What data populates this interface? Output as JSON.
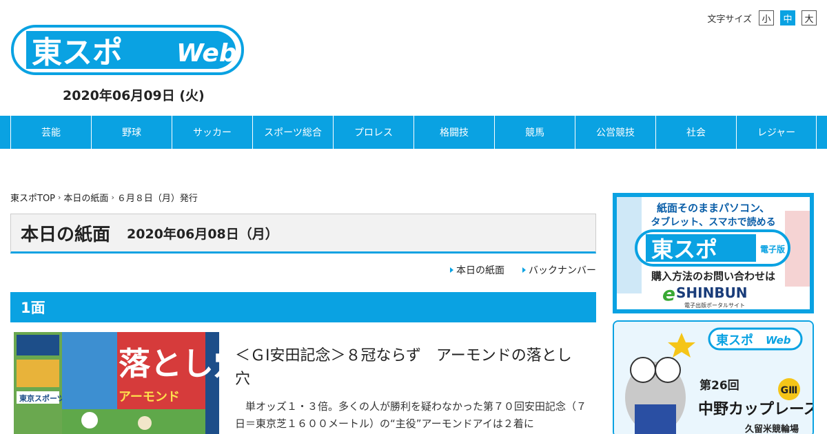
{
  "header": {
    "logo_text": "東スポ",
    "logo_web": "Web",
    "date": "2020年06月09日 (火)"
  },
  "font_size": {
    "label": "文字サイズ",
    "options": [
      "小",
      "中",
      "大"
    ],
    "selected": "中"
  },
  "nav": {
    "items": [
      "芸能",
      "野球",
      "サッカー",
      "スポーツ総合",
      "プロレス",
      "格闘技",
      "競馬",
      "公営競技",
      "社会",
      "レジャー"
    ]
  },
  "breadcrumb": {
    "items": [
      "東スポTOP",
      "本日の紙面",
      "６月８日（月）発行"
    ]
  },
  "page": {
    "title": "本日の紙面",
    "date": "2020年06月08日（月）"
  },
  "subnav": {
    "items": [
      "本日の紙面",
      "バックナンバー"
    ]
  },
  "section": {
    "label": "1面"
  },
  "article": {
    "title": "＜ＧⅠ安田記念＞８冠ならず　アーモンドの落とし穴",
    "body": "単オッズ１・３倍。多くの人が勝利を疑わなかった第７０回安田記念（７日＝東京芝１６００メートル）の“主役”アーモンドアイは２着に"
  },
  "front_page": {
    "paper_name": "東京スポーツ",
    "headline": "落とし穴",
    "sub_headline": "アーモンド"
  },
  "ad_eshinbun": {
    "line1": "紙面そのままパソコン、",
    "line2": "タブレット、スマホで読める",
    "brand": "東スポ",
    "brand_sub": "電子版",
    "cta": "購入方法のお問い合わせは",
    "portal": "SHINBUN",
    "portal_e": "e",
    "portal_desc": "電子出版ポータルサイト"
  },
  "ad_race": {
    "logo": "東スポ",
    "logo_web": "Web",
    "round": "第26回",
    "race": "中野カップレース",
    "grade": "GⅢ",
    "venue": "久留米競輪場"
  },
  "colors": {
    "accent": "#0aa2e2",
    "text": "#222222"
  }
}
